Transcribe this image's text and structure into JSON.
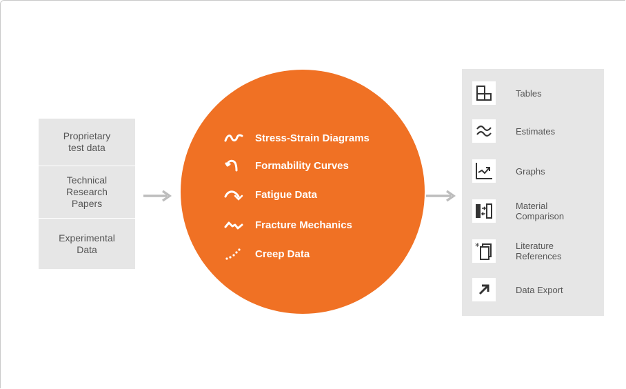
{
  "sources": [
    {
      "label": "Proprietary\ntest data"
    },
    {
      "label": "Technical\nResearch\nPapers"
    },
    {
      "label": "Experimental\nData"
    }
  ],
  "center": {
    "items": [
      {
        "label": "Stress-Strain Diagrams",
        "icon": "wave-icon"
      },
      {
        "label": "Formability Curves",
        "icon": "loop-curve-icon"
      },
      {
        "label": "Fatigue Data",
        "icon": "curved-arrow-icon"
      },
      {
        "label": "Fracture Mechanics",
        "icon": "zigzag-icon"
      },
      {
        "label": "Creep Data",
        "icon": "dotted-curve-icon"
      }
    ]
  },
  "outputs": [
    {
      "label": "Tables",
      "icon": "table-icon"
    },
    {
      "label": "Estimates",
      "icon": "approx-icon"
    },
    {
      "label": "Graphs",
      "icon": "graph-icon"
    },
    {
      "label": "Material\nComparison",
      "icon": "comparison-icon"
    },
    {
      "label": "Literature\nReferences",
      "icon": "references-icon"
    },
    {
      "label": "Data Export",
      "icon": "export-arrow-icon"
    }
  ],
  "colors": {
    "accent": "#f07124",
    "panel": "#e6e6e6",
    "arrow": "#bdbdbd",
    "text": "#555555"
  }
}
